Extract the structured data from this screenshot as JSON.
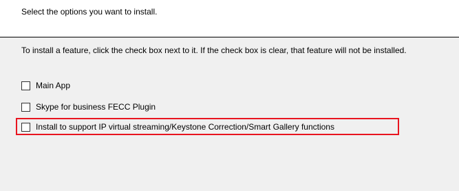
{
  "header": {
    "text": "Select the options you want to install."
  },
  "instructions": {
    "text": "To install a feature, click the check box next to it.  If the check box is clear, that feature will not be installed."
  },
  "options": [
    {
      "label": "Main App",
      "checked": false
    },
    {
      "label": "Skype for business FECC Plugin",
      "checked": false
    },
    {
      "label": "Install to support IP virtual streaming/Keystone Correction/Smart Gallery functions",
      "checked": false,
      "highlighted": true
    }
  ],
  "colors": {
    "highlight": "#e8141f",
    "background": "#f0f0f0",
    "header_background": "#ffffff"
  }
}
